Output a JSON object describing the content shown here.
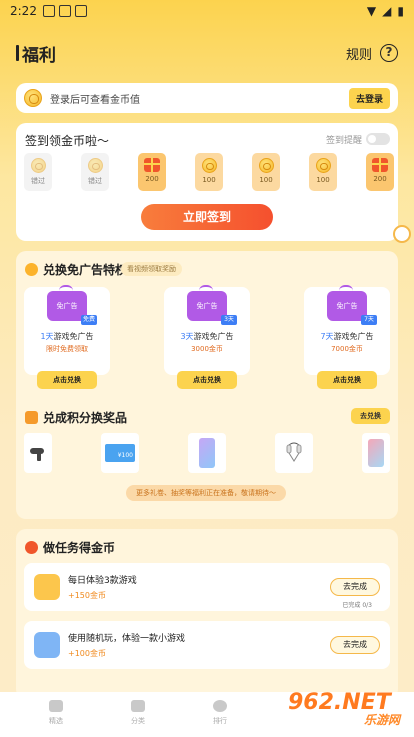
{
  "status": {
    "time": "2:22"
  },
  "header": {
    "title": "福利",
    "rules": "规则",
    "help": "?"
  },
  "login": {
    "text": "登录后可查看金币值",
    "button": "去登录"
  },
  "signin": {
    "title": "签到领金币啦～",
    "remind": "签到提醒",
    "days": [
      {
        "label": "错过",
        "kind": "past"
      },
      {
        "label": "错过",
        "kind": "past"
      },
      {
        "label": "200",
        "kind": "gift"
      },
      {
        "label": "100",
        "kind": "coin"
      },
      {
        "label": "100",
        "kind": "coin"
      },
      {
        "label": "100",
        "kind": "coin"
      },
      {
        "label": "200",
        "kind": "gift"
      }
    ],
    "button": "立即签到"
  },
  "ad": {
    "title": "兑换免广告特权",
    "pill": "看视频领取奖励",
    "cards": [
      {
        "tv": "免广告",
        "tag": "免费",
        "days": "1天",
        "name": "游戏免广告",
        "cost": "限时免费领取",
        "button": "点击兑换"
      },
      {
        "tv": "免广告",
        "tag": "3天",
        "days": "3天",
        "name": "游戏免广告",
        "cost": "3000金币",
        "button": "点击兑换"
      },
      {
        "tv": "免广告",
        "tag": "7天",
        "days": "7天",
        "name": "游戏免广告",
        "cost": "7000金币",
        "button": "点击兑换"
      }
    ]
  },
  "prizes": {
    "title": "兑成积分换奖品",
    "button": "去兑换",
    "more": "更多礼卷、抽奖等福利正在准备，敬请期待～",
    "tag": "¥100"
  },
  "tasks": {
    "title": "做任务得金币",
    "items": [
      {
        "name": "每日体验3款游戏",
        "reward": "+150金币",
        "button": "去完成",
        "progress": "已完成 0/3"
      },
      {
        "name": "使用随机玩，体验一款小游戏",
        "reward": "+100金币",
        "button": "去完成"
      }
    ]
  },
  "tabs": [
    {
      "label": "精选"
    },
    {
      "label": "分类"
    },
    {
      "label": "排行"
    }
  ],
  "watermark": {
    "brand": "962.NET",
    "sub": "乐游网"
  }
}
